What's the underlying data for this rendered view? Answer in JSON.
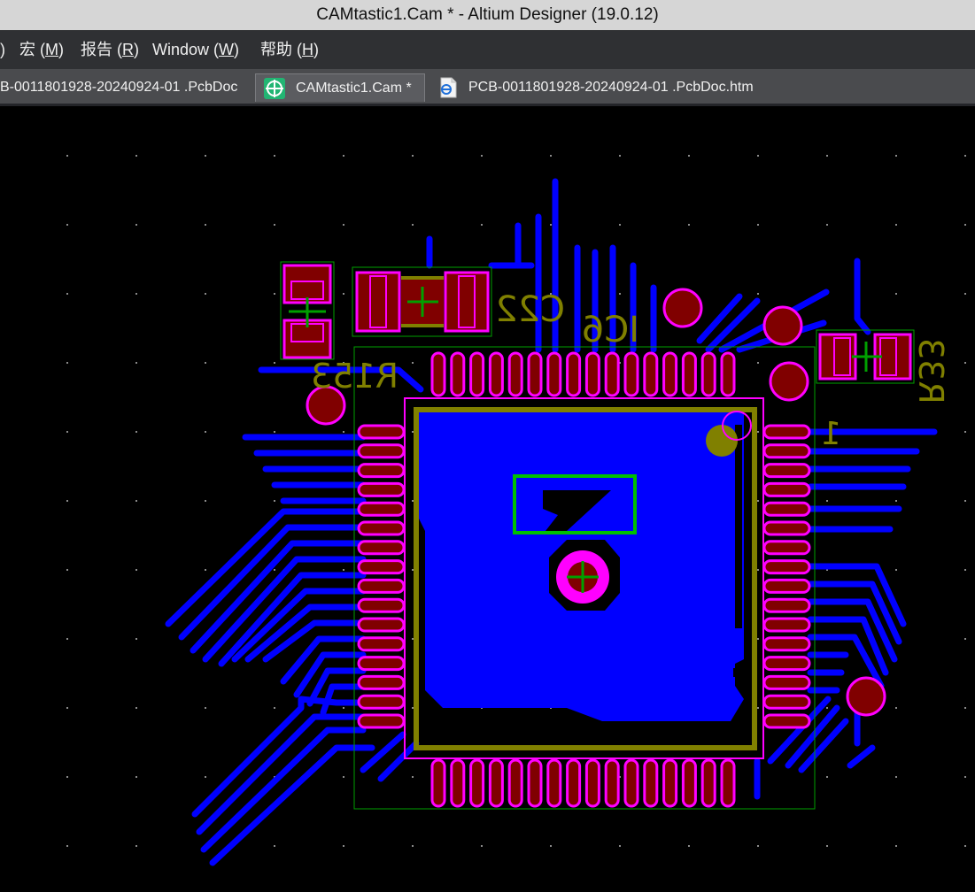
{
  "window": {
    "title": "CAMtastic1.Cam * - Altium Designer (19.0.12)"
  },
  "menu": {
    "items": [
      {
        "text": ")"
      },
      {
        "text": "宏 (",
        "hotkey": "M",
        "tail": ")"
      },
      {
        "text": "报告 (",
        "hotkey": "R",
        "tail": ")"
      },
      {
        "text": "Window (",
        "hotkey": "W",
        "tail": ")"
      },
      {
        "text": "帮助 (",
        "hotkey": "H",
        "tail": ")"
      }
    ]
  },
  "tabs": [
    {
      "label": "B-0011801928-20240924-01 .PcbDoc",
      "icon": ""
    },
    {
      "label": "CAMtastic1.Cam *",
      "icon": "camtastic-icon",
      "active": true
    },
    {
      "label": "PCB-0011801928-20240924-01 .PcbDoc.htm",
      "icon": "html-document-icon"
    }
  ],
  "pcb": {
    "designators": {
      "c22": "C22",
      "ic6": "IC6",
      "r153": "R153",
      "r33": "R33",
      "pin1": "1"
    },
    "colors": {
      "background": "#000000",
      "copper": "#0000ff",
      "pad_fill": "#800000",
      "pad_outline": "#ff00ff",
      "silkscreen": "#808000",
      "mechanical": "#00a000",
      "highlight": "#00c000"
    }
  }
}
